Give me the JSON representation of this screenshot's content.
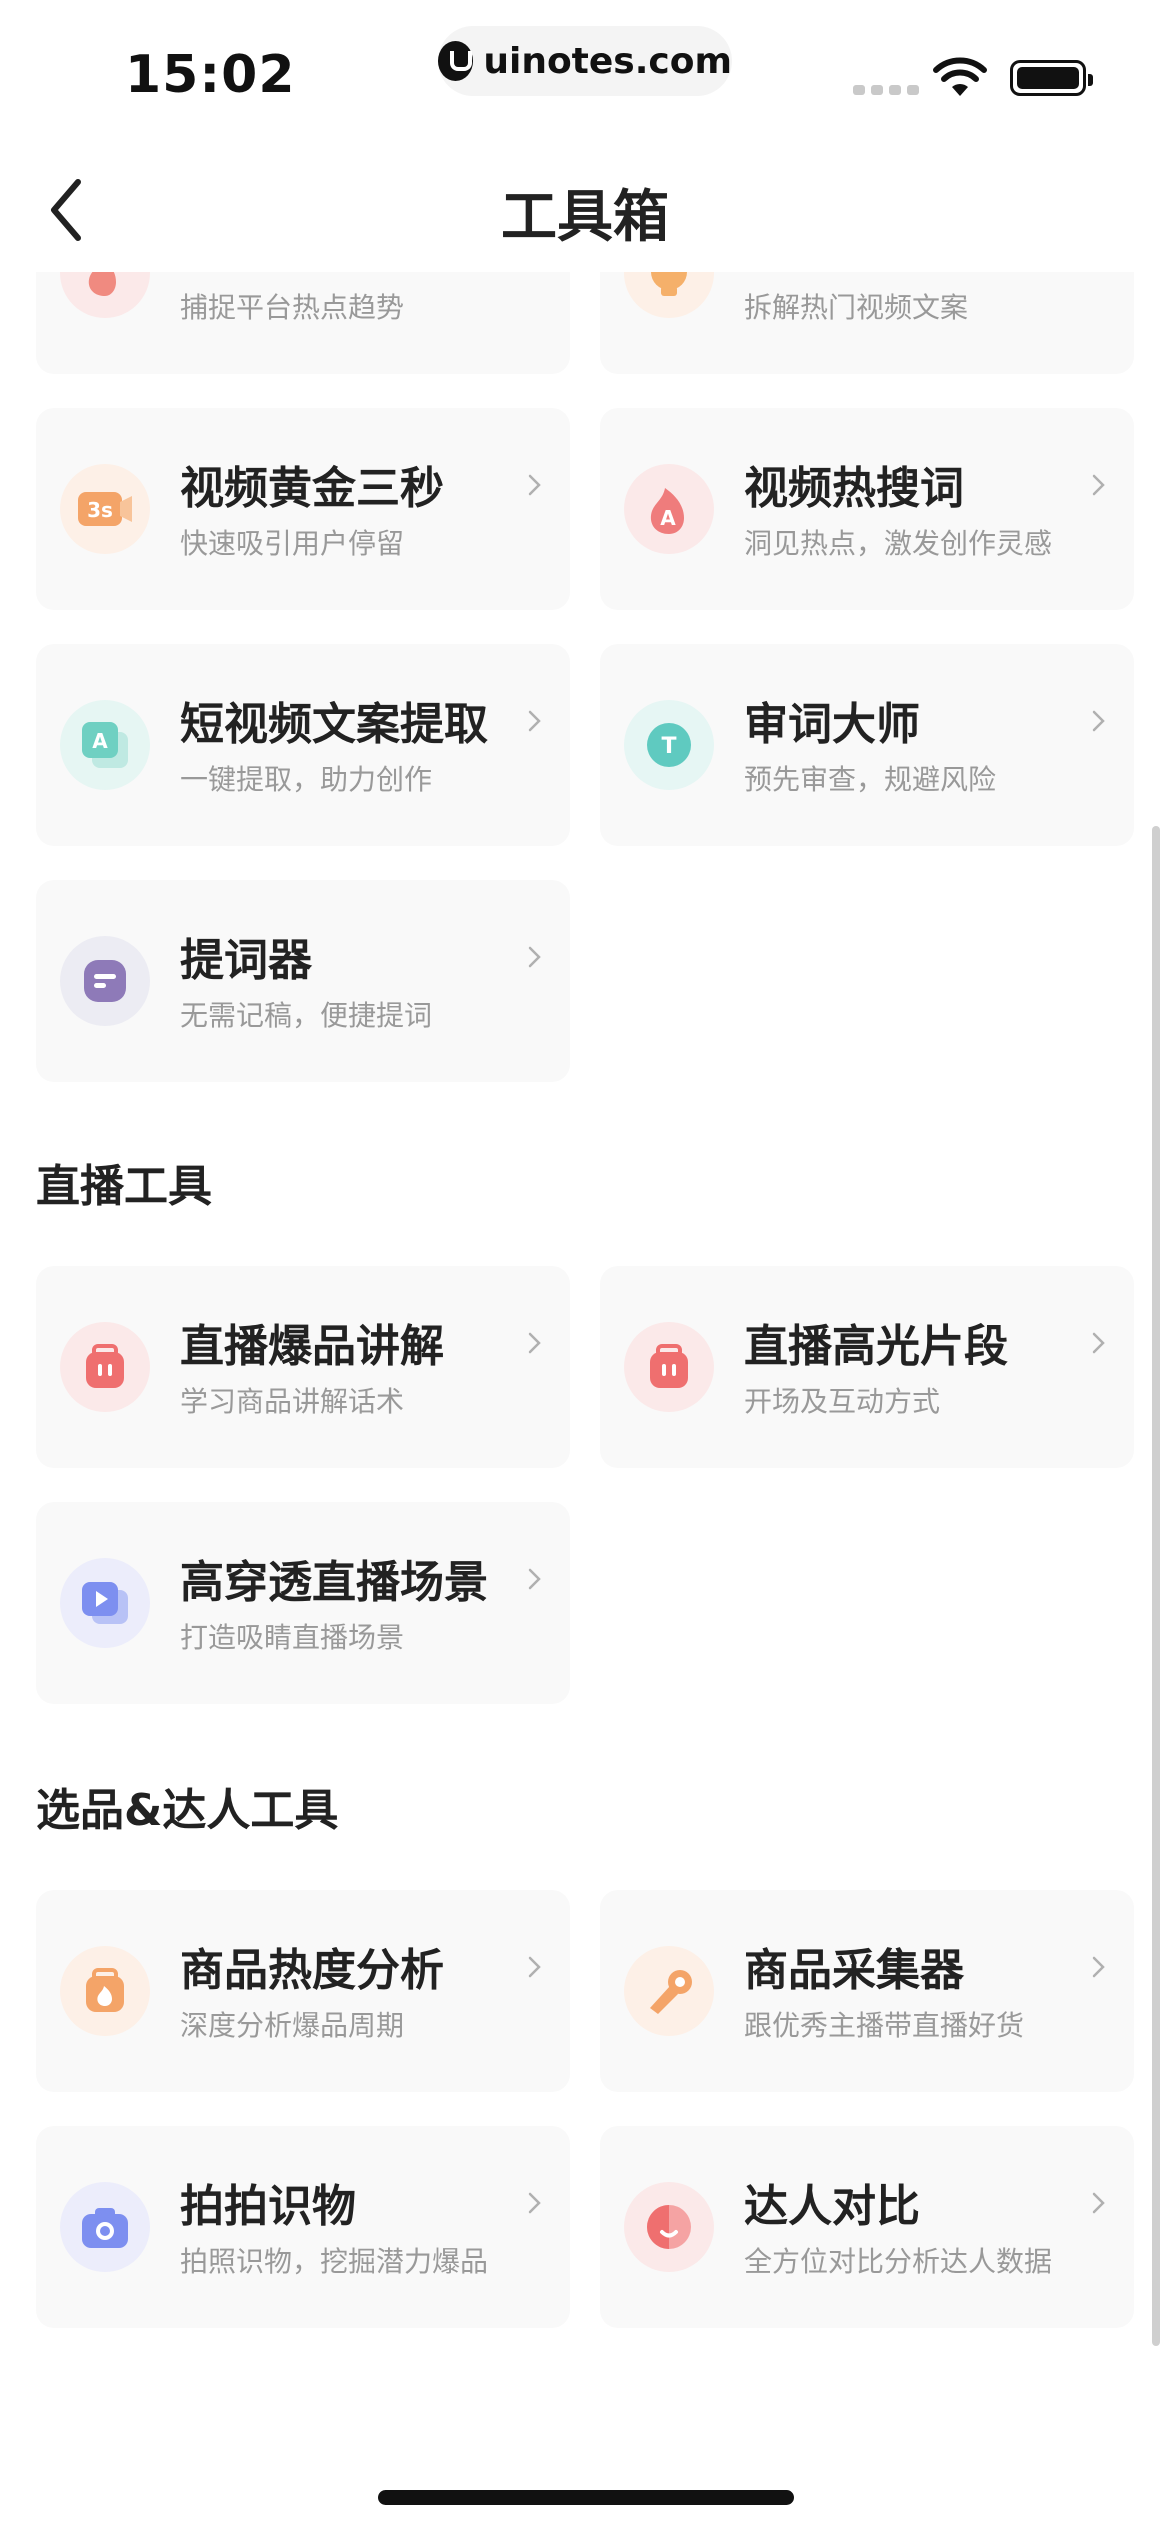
{
  "status_bar": {
    "time": "15:02",
    "url": "uinotes.com"
  },
  "nav": {
    "title": "工具箱"
  },
  "partial_cards": [
    {
      "sub": "捕捉平台热点趋势",
      "icon": "fire-icon",
      "color": "#f08a80"
    },
    {
      "sub": "拆解热门视频文案",
      "icon": "lightbulb-icon",
      "color": "#f5b06a"
    }
  ],
  "video_tools": [
    {
      "title": "视频黄金三秒",
      "sub": "快速吸引用户停留",
      "icon": "3s-video-icon",
      "color": "#f4a468",
      "bg": "#fdf0e7",
      "glyph": "3s"
    },
    {
      "title": "视频热搜词",
      "sub": "洞见热点，激发创作灵感",
      "icon": "hot-search-flame-icon",
      "color": "#ef7c7c",
      "bg": "#fbe9e9",
      "glyph": "A"
    },
    {
      "title": "短视频文案提取",
      "sub": "一键提取，助力创作",
      "icon": "text-extract-icon",
      "color": "#6fd0c2",
      "bg": "#e6f6f3",
      "glyph": "A"
    },
    {
      "title": "审词大师",
      "sub": "预先审查，规避风险",
      "icon": "word-review-icon",
      "color": "#5fcac0",
      "bg": "#e6f6f4",
      "glyph": "T"
    },
    {
      "title": "提词器",
      "sub": "无需记稿，便捷提词",
      "icon": "teleprompter-icon",
      "color": "#8e7ab8",
      "bg": "#ececf3",
      "glyph": ""
    }
  ],
  "sections": {
    "live": "直播工具",
    "selection": "选品&达人工具"
  },
  "live_tools": [
    {
      "title": "直播爆品讲解",
      "sub": "学习商品讲解话术",
      "icon": "live-bag-icon",
      "color": "#ef6f6f",
      "bg": "#fbe9e9"
    },
    {
      "title": "直播高光片段",
      "sub": "开场及互动方式",
      "icon": "live-bag-icon",
      "color": "#ef6f6f",
      "bg": "#fbe9e9"
    },
    {
      "title": "高穿透直播场景",
      "sub": "打造吸睛直播场景",
      "icon": "live-scene-play-icon",
      "color": "#7d8ff0",
      "bg": "#ecedfb"
    }
  ],
  "selection_tools": [
    {
      "title": "商品热度分析",
      "sub": "深度分析爆品周期",
      "icon": "product-heat-icon",
      "color": "#f4a468",
      "bg": "#fdf0e7"
    },
    {
      "title": "商品采集器",
      "sub": "跟优秀主播带直播好货",
      "icon": "product-collector-icon",
      "color": "#f4a468",
      "bg": "#fdf0e7"
    },
    {
      "title": "拍拍识物",
      "sub": "拍照识物，挖掘潜力爆品",
      "icon": "camera-icon",
      "color": "#7d8ff0",
      "bg": "#ecedfb"
    },
    {
      "title": "达人对比",
      "sub": "全方位对比分析达人数据",
      "icon": "influencer-compare-icon",
      "color": "#ef7c7c",
      "bg": "#fbe9e9"
    }
  ]
}
